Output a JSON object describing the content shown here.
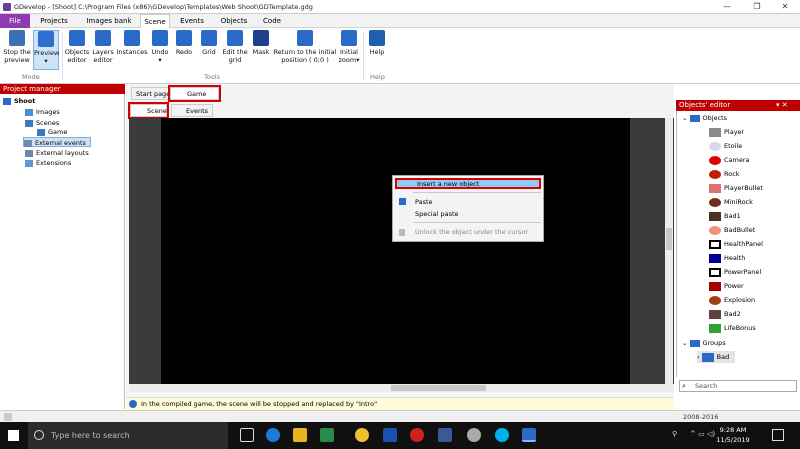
{
  "window": {
    "title": "GDevelop - [Shoot] C:\\Program Files (x86)\\GDevelop\\Templates\\Web Shoot\\GDTemplate.gdg",
    "min": "—",
    "max": "❐",
    "close": "✕"
  },
  "menu_tabs": [
    "File",
    "Projects",
    "Images bank",
    "Scene",
    "Events",
    "Objects",
    "Code"
  ],
  "ribbon": {
    "buttons": [
      {
        "label": "Stop the\npreview",
        "icon": "pencil-icon",
        "color": "#3b6fb6"
      },
      {
        "label": "Preview\n▾",
        "icon": "play-icon",
        "color": "#2f6ed0"
      },
      {
        "label": "Objects\neditor",
        "icon": "objects-icon",
        "color": "#2a6ac9"
      },
      {
        "label": "Layers\neditor",
        "icon": "layers-icon",
        "color": "#2a6ac9"
      },
      {
        "label": "Instances",
        "icon": "instances-icon",
        "color": "#2a6ac9"
      },
      {
        "label": "Undo\n▾",
        "icon": "undo-icon",
        "color": "#2a6ac9"
      },
      {
        "label": "Redo",
        "icon": "redo-icon",
        "color": "#2a6ac9"
      },
      {
        "label": "Grid",
        "icon": "grid-icon",
        "color": "#2a6ac9"
      },
      {
        "label": "Edit the\ngrid",
        "icon": "edit-grid-icon",
        "color": "#2a6ac9"
      },
      {
        "label": "Mask",
        "icon": "mask-icon",
        "color": "#1e3f8a"
      },
      {
        "label": "Return to the initial\nposition ( 0;0 )",
        "icon": "origin-icon",
        "color": "#2a6ac9"
      },
      {
        "label": "Initial\nzoom▾",
        "icon": "zoom-icon",
        "color": "#2a6ac9"
      },
      {
        "label": "Help",
        "icon": "help-icon",
        "color": "#1e5fb0"
      }
    ],
    "groups": {
      "mode": "Mode",
      "tools": "Tools",
      "help": "Help"
    }
  },
  "project_manager": {
    "title": "Project manager",
    "tree": [
      {
        "label": "Shoot",
        "icon": "project-icon",
        "bold": true
      },
      {
        "label": "Images",
        "icon": "images-icon"
      },
      {
        "label": "Scenes",
        "icon": "scenes-icon"
      },
      {
        "label": "Game",
        "icon": "scene-icon"
      },
      {
        "label": "External events",
        "icon": "external-events-icon",
        "selected": true
      },
      {
        "label": "External layouts",
        "icon": "external-layouts-icon"
      },
      {
        "label": "Extensions",
        "icon": "extensions-icon"
      }
    ]
  },
  "editor_tabs": {
    "start_page": "Start page",
    "game": "Game",
    "close": "✕"
  },
  "sub_tabs": {
    "scene": "Scene",
    "events": "Events"
  },
  "context_menu": {
    "insert": "Insert a new object",
    "paste": "Paste",
    "special_paste": "Special paste",
    "unlock": "Unlock the object under the cursor"
  },
  "status_bar": {
    "text": "In the compiled game, the scene will be stopped and replaced by \"Intro\""
  },
  "objects_editor": {
    "title": "Objects' editor",
    "root": "Objects",
    "objects": [
      {
        "name": "Player",
        "color": "#8a8a8a"
      },
      {
        "name": "Etoile",
        "color": "#d8d8f0"
      },
      {
        "name": "Camera",
        "color": "#e00000"
      },
      {
        "name": "Rock",
        "color": "#c02000"
      },
      {
        "name": "PlayerBullet",
        "color": "#e07070"
      },
      {
        "name": "MiniRock",
        "color": "#703020"
      },
      {
        "name": "Bad1",
        "color": "#503020"
      },
      {
        "name": "BadBullet",
        "color": "#f09080"
      },
      {
        "name": "HealthPanel",
        "color": "#000000"
      },
      {
        "name": "Health",
        "color": "#000090"
      },
      {
        "name": "PowerPanel",
        "color": "#000000"
      },
      {
        "name": "Power",
        "color": "#a00000"
      },
      {
        "name": "Explosion",
        "color": "#a04010"
      },
      {
        "name": "Bad2",
        "color": "#604040"
      },
      {
        "name": "LifeBonus",
        "color": "#30a030"
      }
    ],
    "groups_label": "Groups",
    "groups": [
      "Bad"
    ],
    "search_placeholder": "Search"
  },
  "footer": {
    "years": "2008-2016"
  },
  "taskbar": {
    "search_placeholder": "Type here to search",
    "time": "9:28 AM",
    "date": "11/5/2019"
  }
}
